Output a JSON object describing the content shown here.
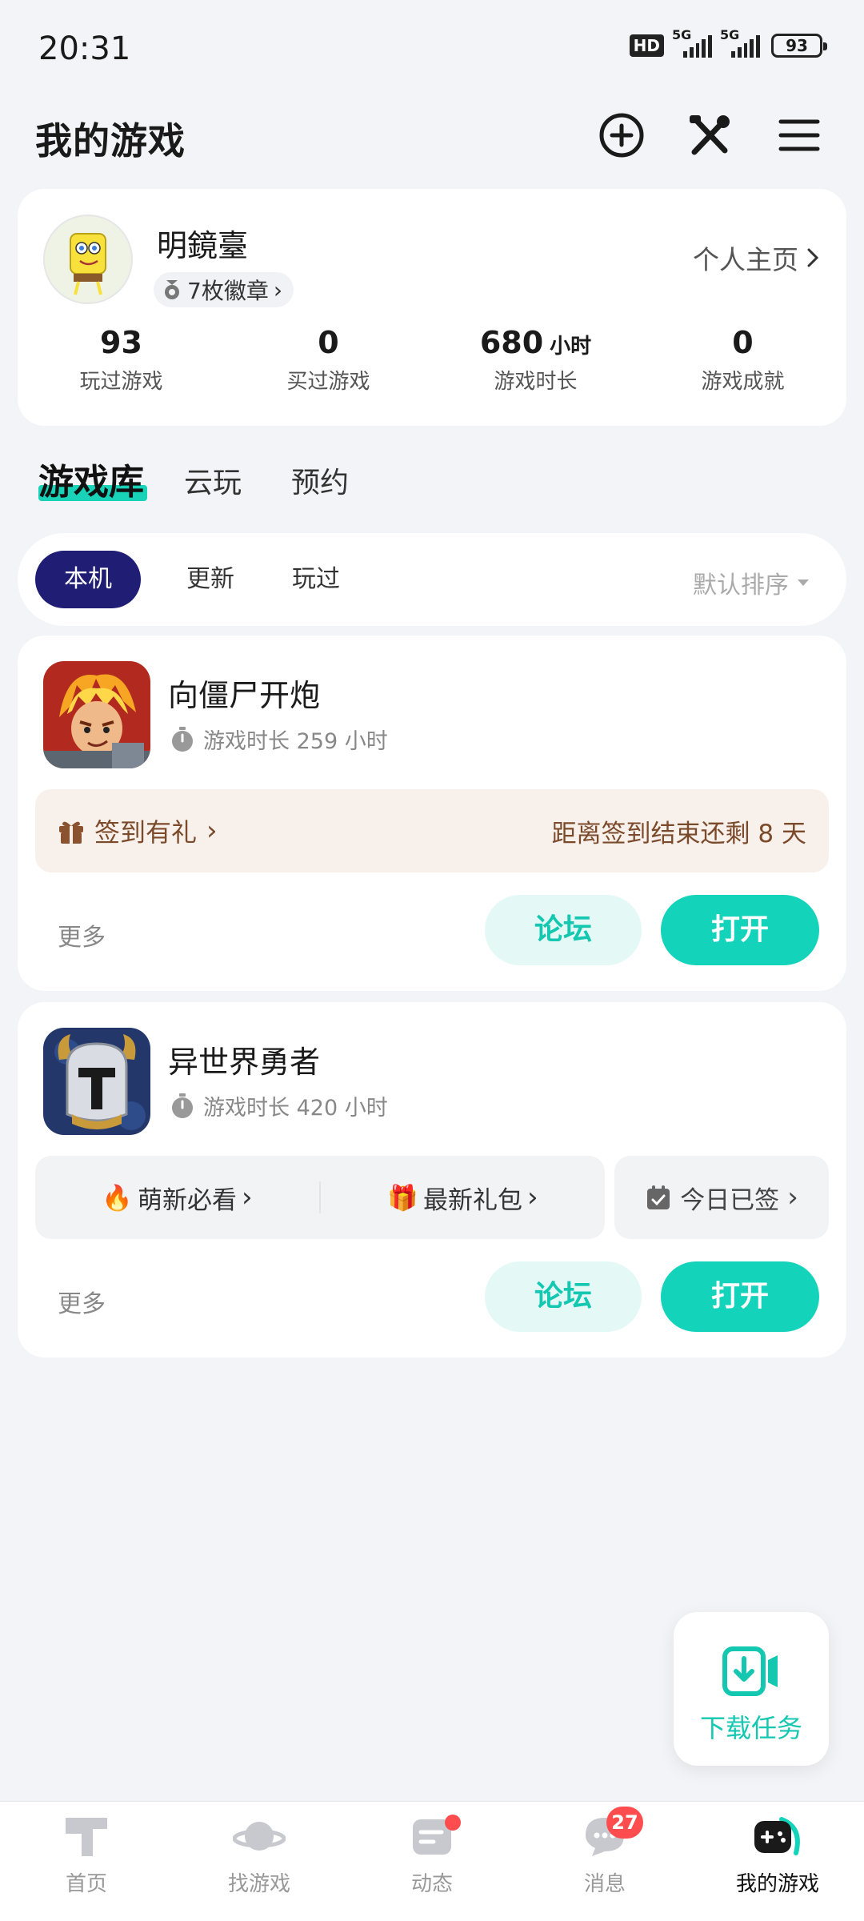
{
  "status_bar": {
    "time": "20:31",
    "hd_label": "HD",
    "network_1": "5G",
    "network_2": "5G",
    "battery": "93"
  },
  "header": {
    "title": "我的游戏",
    "icons": [
      "add-circle-icon",
      "tools-icon",
      "menu-icon"
    ]
  },
  "profile": {
    "name": "明鏡臺",
    "badges_label": "7枚徽章",
    "home_link": "个人主页",
    "stats": [
      {
        "value": "93",
        "unit": "",
        "label": "玩过游戏"
      },
      {
        "value": "0",
        "unit": "",
        "label": "买过游戏"
      },
      {
        "value": "680",
        "unit": "小时",
        "label": "游戏时长"
      },
      {
        "value": "0",
        "unit": "",
        "label": "游戏成就"
      }
    ]
  },
  "main_tabs": [
    "游戏库",
    "云玩",
    "预约"
  ],
  "filters": {
    "chips": [
      "本机",
      "更新",
      "玩过"
    ],
    "sort_label": "默认排序"
  },
  "games": [
    {
      "name": "向僵尸开炮",
      "play_time": "游戏时长 259 小时",
      "promo_left": "签到有礼",
      "promo_right": "距离签到结束还剩 8 天",
      "more": "更多",
      "forum": "论坛",
      "open": "打开"
    },
    {
      "name": "异世界勇者",
      "play_time": "游戏时长 420 小时",
      "tip_1": "萌新必看",
      "tip_2": "最新礼包",
      "checkin": "今日已签",
      "more": "更多",
      "forum": "论坛",
      "open": "打开"
    }
  ],
  "download_task": {
    "label": "下载任务"
  },
  "bottom_nav": [
    {
      "label": "首页",
      "icon": "home-icon"
    },
    {
      "label": "找游戏",
      "icon": "planet-icon"
    },
    {
      "label": "动态",
      "icon": "feed-icon"
    },
    {
      "label": "消息",
      "icon": "message-icon",
      "badge": "27"
    },
    {
      "label": "我的游戏",
      "icon": "gamepad-icon"
    }
  ],
  "colors": {
    "accent": "#14d3bb",
    "chip_active": "#1f1e74",
    "promo_bg": "#f8f0eb",
    "promo_text": "#7b4a2a",
    "badge_red": "#ff4d4f"
  }
}
